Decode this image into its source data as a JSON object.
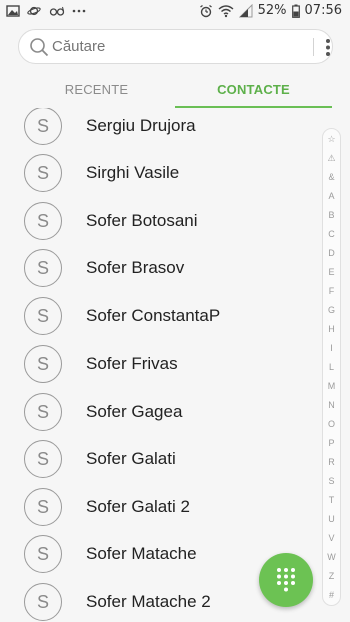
{
  "status_bar": {
    "left_icons": [
      "gallery-icon",
      "saturn-icon",
      "glasses-icon",
      "more-dots-icon"
    ],
    "right_icons": [
      "alarm-icon",
      "wifi-icon",
      "signal-icon",
      "battery-icon"
    ],
    "battery": "52%",
    "time": "07:56"
  },
  "search": {
    "placeholder": "Căutare"
  },
  "tabs": [
    {
      "label": "RECENTE",
      "active": false
    },
    {
      "label": "CONTACTE",
      "active": true
    }
  ],
  "contacts": [
    {
      "initial": "S",
      "name": "Sergiu Drujora"
    },
    {
      "initial": "S",
      "name": "Sirghi Vasile"
    },
    {
      "initial": "S",
      "name": "Sofer Botosani"
    },
    {
      "initial": "S",
      "name": "Sofer Brasov"
    },
    {
      "initial": "S",
      "name": "Sofer ConstantaP"
    },
    {
      "initial": "S",
      "name": "Sofer Frivas"
    },
    {
      "initial": "S",
      "name": "Sofer Gagea"
    },
    {
      "initial": "S",
      "name": "Sofer Galati"
    },
    {
      "initial": "S",
      "name": "Sofer Galati 2"
    },
    {
      "initial": "S",
      "name": "Sofer Matache"
    },
    {
      "initial": "S",
      "name": "Sofer Matache 2"
    }
  ],
  "index": [
    "☆",
    "⚠",
    "&",
    "A",
    "B",
    "C",
    "D",
    "E",
    "F",
    "G",
    "H",
    "I",
    "L",
    "M",
    "N",
    "O",
    "P",
    "R",
    "S",
    "T",
    "U",
    "V",
    "W",
    "Z",
    "#"
  ],
  "colors": {
    "accent": "#5db04a",
    "fab": "#6cc253"
  }
}
